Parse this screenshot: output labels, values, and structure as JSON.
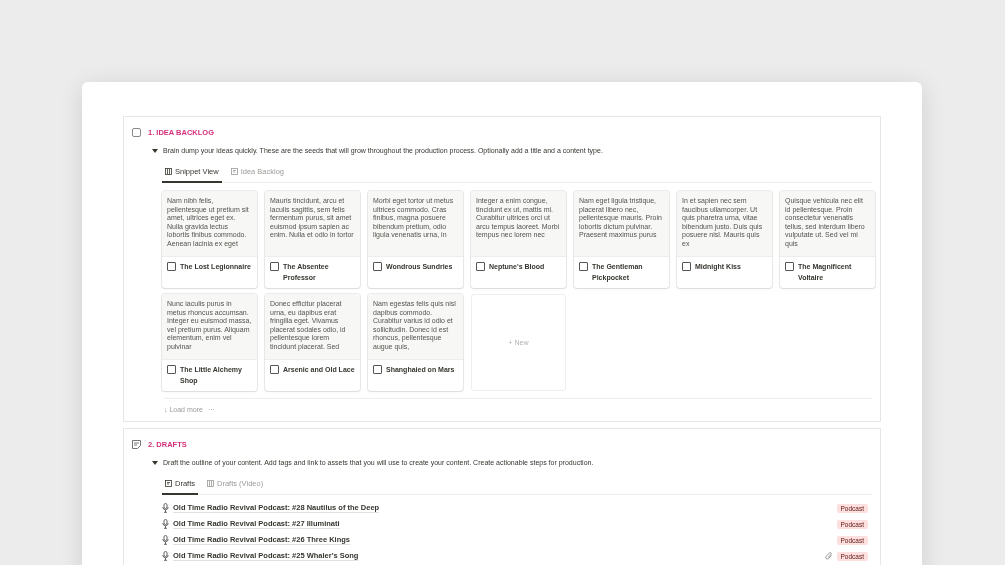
{
  "sections": [
    {
      "kind": "gallery",
      "title": "1. IDEA BACKLOG",
      "description": "Brain dump your ideas quickly. These are the seeds that will grow throughout the production process. Optionally add a title and a content type.",
      "expanded": true,
      "tabs": [
        {
          "label": "Snippet View",
          "kind": "grid",
          "selected": true
        },
        {
          "label": "Idea Backlog",
          "kind": "list",
          "selected": false
        }
      ],
      "cards": [
        {
          "snippet": "Nam nibh felis, pellentesque ut pretium sit amet, ultrices eget ex. Nulla gravida lectus lobortis finibus commodo. Aenean lacinia ex eget",
          "title": "The Lost Legionnaire",
          "checked": false
        },
        {
          "snippet": "Mauris tincidunt, arcu et iaculis sagittis, sem felis fermentum purus, sit amet euismod ipsum sapien ac enim. Nulla et odio in tortor",
          "title": "The Absentee Professor",
          "checked": false
        },
        {
          "snippet": "Morbi eget tortor ut metus ultrices commodo. Cras finibus, magna posuere bibendum pretium, odio ligula venenatis urna, in",
          "title": "Wondrous Sundries",
          "checked": false
        },
        {
          "snippet": "Integer a enim congue, tincidunt ex ut, mattis mi. Curabitur ultrices orci ut arcu tempus laoreet. Morbi tempus nec lorem nec",
          "title": "Neptune's Blood",
          "checked": false
        },
        {
          "snippet": "Nam eget ligula tristique, placerat libero nec, pellentesque mauris. Proin lobortis dictum pulvinar. Praesent maximus purus",
          "title": "The Gentleman Pickpocket",
          "checked": false
        },
        {
          "snippet": "In et sapien nec sem faucibus ullamcorper. Ut quis pharetra urna, vitae bibendum justo. Duis quis posuere nisl. Mauris quis ex",
          "title": "Midnight Kiss",
          "checked": false
        },
        {
          "snippet": "Quisque vehicula nec elit id pellentesque. Proin consectetur venenatis tellus, sed interdum libero vulputate ut. Sed vel mi quis",
          "title": "The Magnificent Voltaire",
          "checked": false
        },
        {
          "snippet": "Nunc iaculis purus in metus rhoncus accumsan. Integer eu euismod massa, vel pretium purus. Aliquam elementum, enim vel pulvinar",
          "title": "The Little Alchemy Shop",
          "checked": false
        },
        {
          "snippet": "Donec efficitur placerat urna, eu dapibus erat fringilla eget. Vivamus placerat sodales odio, id pellentesque lorem tincidunt placerat. Sed",
          "title": "Arsenic and Old Lace",
          "checked": false
        },
        {
          "snippet": "Nam egestas felis quis nisl dapibus commodo. Curabitur varius id odio et sollicitudin. Donec id est rhoncus, pellentesque augue quis,",
          "title": "Shanghaied on Mars",
          "checked": false
        }
      ],
      "new_label": "+ New",
      "load_more": "↓ Load more",
      "more": "···"
    },
    {
      "kind": "list",
      "title": "2. DRAFTS",
      "description": "Draft the outline of your content. Add tags and link to assets that you will use to create your content. Create actionable steps for production.",
      "expanded": true,
      "tabs": [
        {
          "label": "Drafts",
          "kind": "list",
          "selected": true
        },
        {
          "label": "Drafts (Video)",
          "kind": "grid",
          "selected": false
        }
      ],
      "rows": [
        {
          "title": "Old Time Radio Revival Podcast: #28 Nautilus of the Deep",
          "attachment": false,
          "tag": "Podcast",
          "color": "#fde0de"
        },
        {
          "title": "Old Time Radio Revival Podcast: #27 Illuminati",
          "attachment": false,
          "tag": "Podcast",
          "color": "#fde0de"
        },
        {
          "title": "Old Time Radio Revival Podcast: #26 Three Kings",
          "attachment": false,
          "tag": "Podcast",
          "color": "#fde0de"
        },
        {
          "title": "Old Time Radio Revival Podcast: #25 Whaler's Song",
          "attachment": true,
          "tag": "Podcast",
          "color": "#fde0de"
        }
      ]
    }
  ]
}
